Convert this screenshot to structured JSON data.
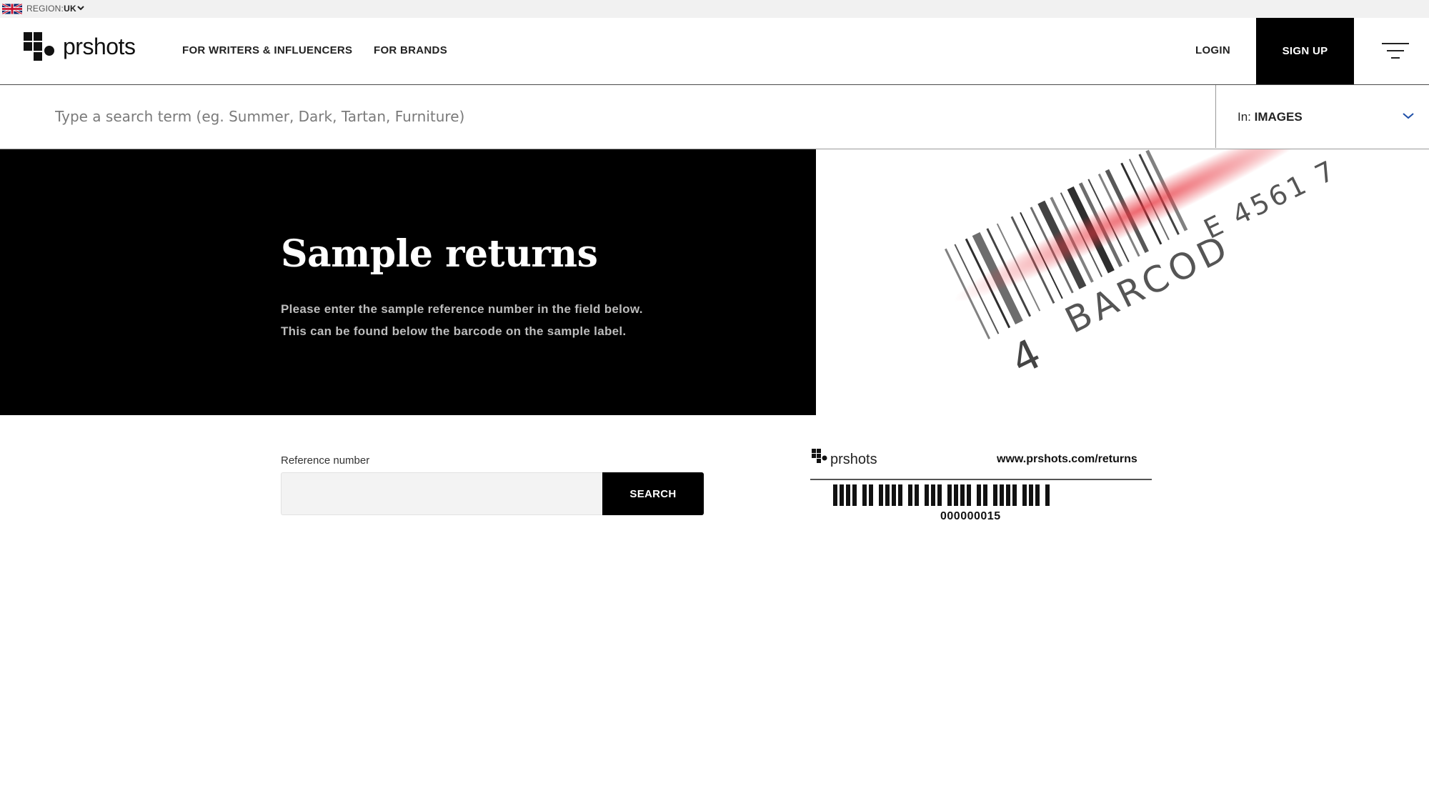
{
  "region": {
    "label": "REGION:",
    "value": "UK",
    "flag_icon": "uk-flag-icon",
    "chevron_icon": "chevron-down-icon"
  },
  "header": {
    "logo_text": "prshots",
    "nav": {
      "writers": "FOR WRITERS & INFLUENCERS",
      "brands": "FOR BRANDS"
    },
    "login": "LOGIN",
    "signup": "SIGN UP",
    "menu_icon": "hamburger-menu-icon"
  },
  "search": {
    "placeholder": "Type a search term (eg. Summer, Dark, Tartan, Furniture)",
    "value": "",
    "scope_prefix": "In: ",
    "scope_value": "IMAGES"
  },
  "hero": {
    "title": "Sample returns",
    "description_line1": "Please enter the sample reference number in the field below.",
    "description_line2": "This can be found below the barcode on the sample label.",
    "image_text_number": "4",
    "image_text_barcode": "BARCOD",
    "image_text_code": "E 4561 7"
  },
  "form": {
    "label": "Reference number",
    "value": "",
    "button": "SEARCH"
  },
  "sample_label": {
    "logo_text": "prshots",
    "url": "www.prshots.com/returns",
    "reference": "000000015"
  },
  "colors": {
    "black": "#000000",
    "scan_red": "#e8323c",
    "background": "#ffffff"
  }
}
